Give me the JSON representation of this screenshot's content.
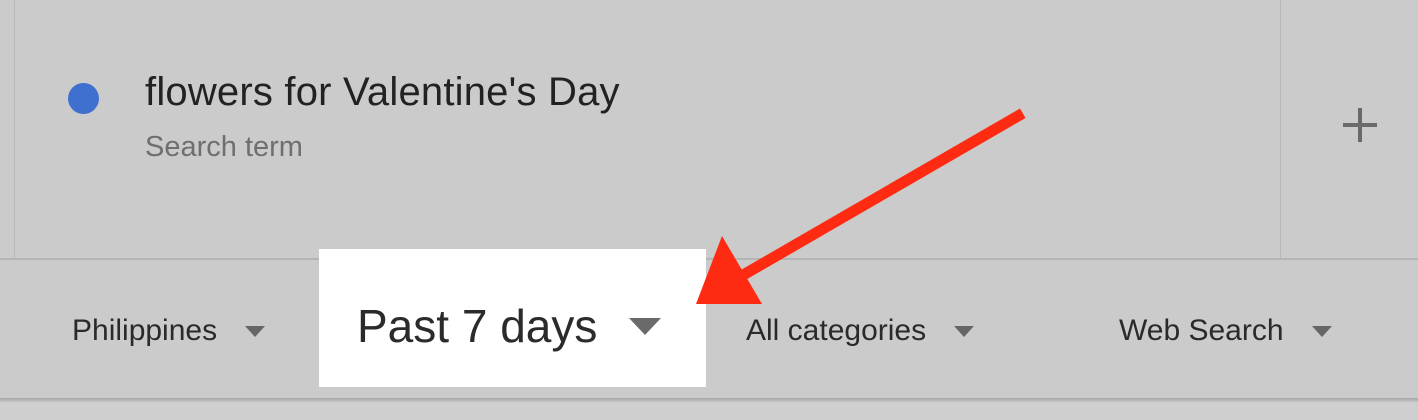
{
  "search_term": {
    "title": "flowers for Valentine's Day",
    "subtitle": "Search term",
    "dot_color": "#3f6fcf",
    "add_icon": "plus-icon"
  },
  "filters": {
    "country": {
      "label": "Philippines",
      "icon": "chevron-down-icon"
    },
    "time_range": {
      "label": "Past 7 days",
      "icon": "chevron-down-icon"
    },
    "category": {
      "label": "All categories",
      "icon": "chevron-down-icon"
    },
    "property": {
      "label": "Web Search",
      "icon": "chevron-down-icon"
    }
  },
  "annotation": {
    "arrow_color": "#ff2a12",
    "icon": "arrow-icon"
  }
}
